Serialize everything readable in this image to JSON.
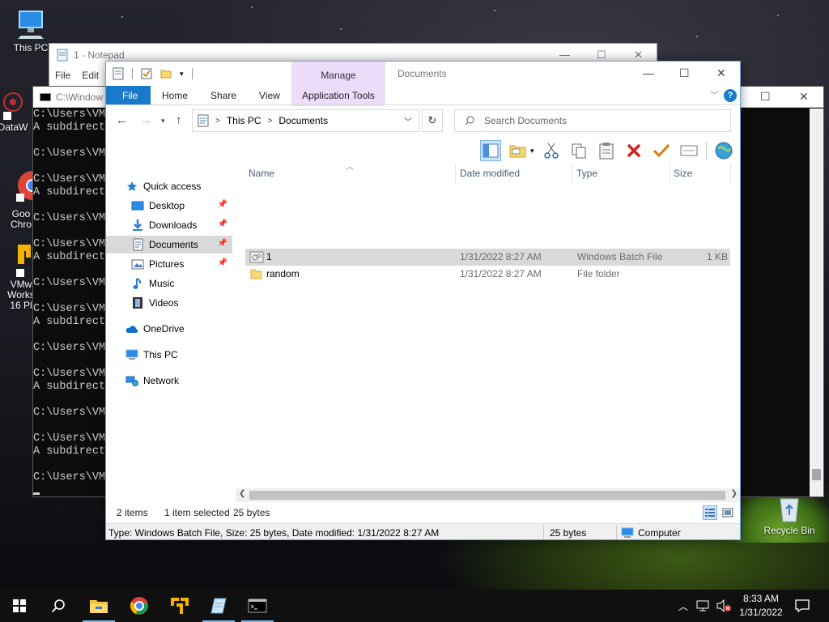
{
  "desktop": {
    "icons": [
      {
        "label": "This PC"
      },
      {
        "label": "DataW"
      },
      {
        "label": "Goo"
      },
      {
        "label": "Chro"
      },
      {
        "label": "VMw"
      },
      {
        "label": "Works"
      },
      {
        "label": "16 Pl"
      },
      {
        "label": "Recycle Bin"
      }
    ]
  },
  "notepad": {
    "title": "1 - Notepad",
    "menu": [
      "File",
      "Edit"
    ]
  },
  "cmd": {
    "title": "C:\\Window",
    "lines": [
      "C:\\Users\\VM",
      "A subdirecto",
      "",
      "C:\\Users\\VM",
      "",
      "C:\\Users\\VM",
      "A subdirecto",
      "",
      "C:\\Users\\VM",
      "",
      "C:\\Users\\VM",
      "A subdirecto",
      "",
      "C:\\Users\\VM",
      "",
      "C:\\Users\\VM",
      "A subdirecto",
      "",
      "C:\\Users\\VM",
      "",
      "C:\\Users\\VM",
      "A subdirecto",
      "",
      "C:\\Users\\VM",
      "",
      "C:\\Users\\VM",
      "A subdirecto",
      "",
      "C:\\Users\\VM"
    ]
  },
  "explorer": {
    "title": "Documents",
    "context_tab": "Manage",
    "tabs": {
      "file": "File",
      "home": "Home",
      "share": "Share",
      "view": "View",
      "app_tools": "Application Tools"
    },
    "help": "?",
    "address": {
      "crumbs": [
        "This PC",
        "Documents"
      ],
      "sep": ">"
    },
    "search_placeholder": "Search Documents",
    "nav": {
      "quick_access": "Quick access",
      "desktop": "Desktop",
      "downloads": "Downloads",
      "documents": "Documents",
      "pictures": "Pictures",
      "music": "Music",
      "videos": "Videos",
      "onedrive": "OneDrive",
      "thispc": "This PC",
      "network": "Network"
    },
    "columns": {
      "name": "Name",
      "date": "Date modified",
      "type": "Type",
      "size": "Size"
    },
    "files": [
      {
        "name": "1",
        "date": "1/31/2022 8:27 AM",
        "type": "Windows Batch File",
        "size": "1 KB"
      },
      {
        "name": "random",
        "date": "1/31/2022 8:27 AM",
        "type": "File folder",
        "size": ""
      }
    ],
    "status": {
      "items": "2 items",
      "selected": "1 item selected",
      "bytes": "25 bytes"
    },
    "details": {
      "info": "Type: Windows Batch File, Size: 25 bytes, Date modified: 1/31/2022 8:27 AM",
      "size": "25 bytes",
      "location": "Computer"
    }
  },
  "taskbar": {
    "time": "8:33 AM",
    "date": "1/31/2022"
  },
  "colors": {
    "accent": "#1979ca",
    "selection": "#d9d9d9",
    "manage_tab": "#eddcf9",
    "taskbar": "#101010"
  }
}
